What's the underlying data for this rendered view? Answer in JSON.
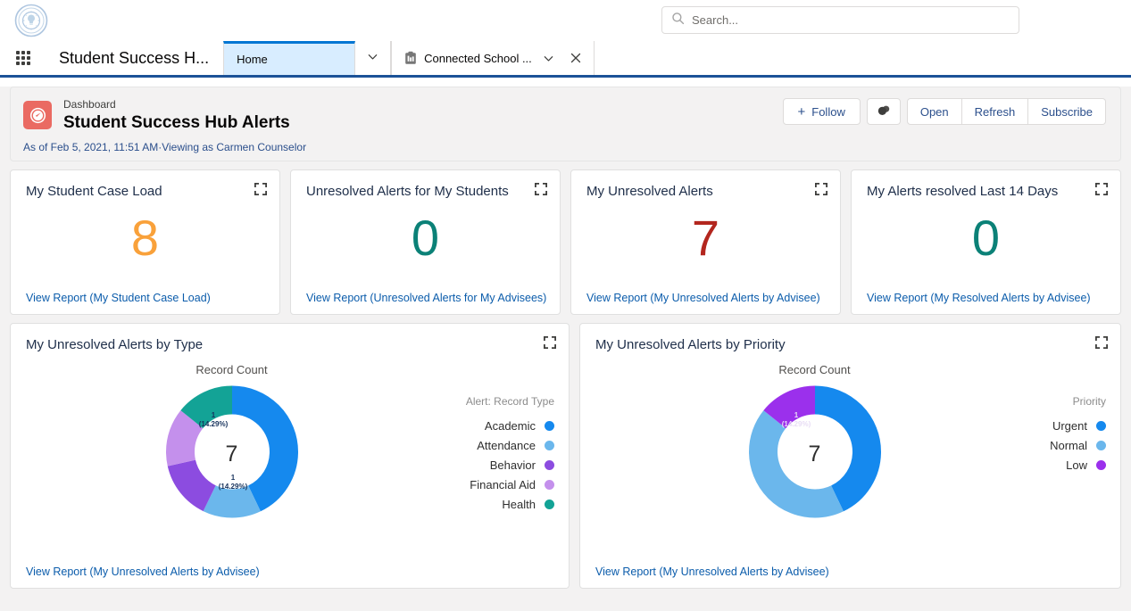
{
  "header": {
    "logo_alt": "university-seal-logo",
    "search": {
      "placeholder": "Search...",
      "value": ""
    }
  },
  "appnav": {
    "launcher_name": "App Launcher",
    "app_name": "Student Success H...",
    "tabs": [
      {
        "label": "Home",
        "icon": "",
        "active": true,
        "has_chevron": false,
        "has_close": false
      },
      {
        "label": "Connected School ...",
        "icon": "clipboard-icon",
        "active": false,
        "has_chevron": true,
        "has_close": true
      }
    ]
  },
  "dashboard": {
    "eyebrow": "Dashboard",
    "title": "Student Success Hub Alerts",
    "subtitle": "As of Feb 5, 2021, 11:51 AM·Viewing as Carmen Counselor",
    "icon": "dashboard-gauge-icon",
    "icon_color": "#ea6a62",
    "actions": {
      "follow": "Follow",
      "display_icon": "display-density-icon",
      "open": "Open",
      "refresh": "Refresh",
      "subscribe": "Subscribe"
    }
  },
  "metrics": [
    {
      "title": "My Student Case Load",
      "value": "8",
      "color": "#f9a13a",
      "link": "View Report (My Student Case Load)"
    },
    {
      "title": "Unresolved Alerts for My Students",
      "value": "0",
      "color": "#0b8177",
      "link": "View Report (Unresolved Alerts for My Advisees)"
    },
    {
      "title": "My Unresolved Alerts",
      "value": "7",
      "color": "#b3261e",
      "link": "View Report (My Unresolved Alerts by Advisee)"
    },
    {
      "title": "My Alerts resolved Last 14 Days",
      "value": "0",
      "color": "#0b8177",
      "link": "View Report (My Resolved Alerts by Advisee)"
    }
  ],
  "charts": [
    {
      "title": "My Unresolved Alerts by Type",
      "link": "View Report (My Unresolved Alerts by Advisee)",
      "legend_title": "Alert: Record Type",
      "chart_data": {
        "type": "pie",
        "title": "My Unresolved Alerts by Type",
        "measure_label": "Record Count",
        "center_total": "7",
        "total": 7,
        "categories": [
          "Academic",
          "Attendance",
          "Behavior",
          "Financial Aid",
          "Health"
        ],
        "values": [
          3,
          1,
          1,
          1,
          1
        ],
        "percents": [
          "42.86%",
          "14.29%",
          "14.29%",
          "14.29%",
          "14.29%"
        ],
        "colors": [
          "#1589ee",
          "#6bb7ec",
          "#8c4ce0",
          "#c490ec",
          "#13a396"
        ],
        "labels_shown": [
          {
            "category": "Attendance",
            "text_value": "1",
            "text_percent": "(14.29%)"
          },
          {
            "category": "Health",
            "text_value": "1",
            "text_percent": "(14.29%)"
          }
        ],
        "legend_position": "right",
        "grid": false
      }
    },
    {
      "title": "My Unresolved Alerts by Priority",
      "link": "View Report (My Unresolved Alerts by Advisee)",
      "legend_title": "Priority",
      "chart_data": {
        "type": "pie",
        "title": "My Unresolved Alerts by Priority",
        "measure_label": "Record Count",
        "center_total": "7",
        "total": 7,
        "categories": [
          "Urgent",
          "Normal",
          "Low"
        ],
        "values": [
          3,
          3,
          1
        ],
        "percents": [
          "42.86%",
          "42.86%",
          "14.29%"
        ],
        "colors": [
          "#1589ee",
          "#6bb7ec",
          "#9b30ec"
        ],
        "labels_shown": [
          {
            "category": "Low",
            "text_value": "1",
            "text_percent": "(14.29%)"
          }
        ],
        "legend_position": "right",
        "grid": false
      }
    }
  ]
}
